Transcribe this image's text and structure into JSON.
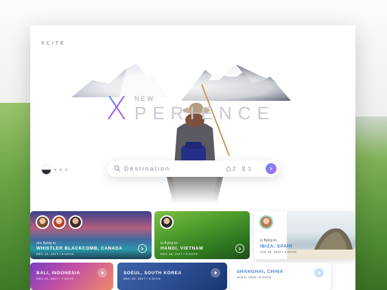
{
  "app": {
    "logo": "XCITE"
  },
  "hero": {
    "x_letter": "X",
    "small_word": "NEW",
    "big_word": "PERIENCE"
  },
  "search": {
    "placeholder": "Destination",
    "count_a": "2",
    "count_b": "1"
  },
  "trips": [
    {
      "label": "are flying to",
      "destination": "WHISTLER BLACKCOMB, CANADA",
      "meta": "DEC 12, 2017 • 5 DAYS"
    },
    {
      "label": "is flying to",
      "destination": "HANOI, VIETNAM",
      "meta": "DEC 25, 2017 • 5 DAYS"
    },
    {
      "label": "is flying to",
      "destination": "IBIZA, SPAIN",
      "meta": "JAN 16, 2018 • 6 DAYS"
    },
    {
      "label": "",
      "destination": "BALI, INDONESIA",
      "meta": "DEC 21, 2017 • 7 DAYS"
    },
    {
      "label": "",
      "destination": "SOEUL, SOUTH KOREA",
      "meta": "DEC 23, 2017 • 5 DAYS"
    },
    {
      "label": "",
      "destination": "SHANGHAI, CHINA",
      "meta": "JAN 6, 2018 • 5 DAYS"
    }
  ],
  "colors": {
    "accent_start": "#6a8cf7",
    "accent_end": "#b066f0",
    "link_blue": "#3d7bdc"
  }
}
